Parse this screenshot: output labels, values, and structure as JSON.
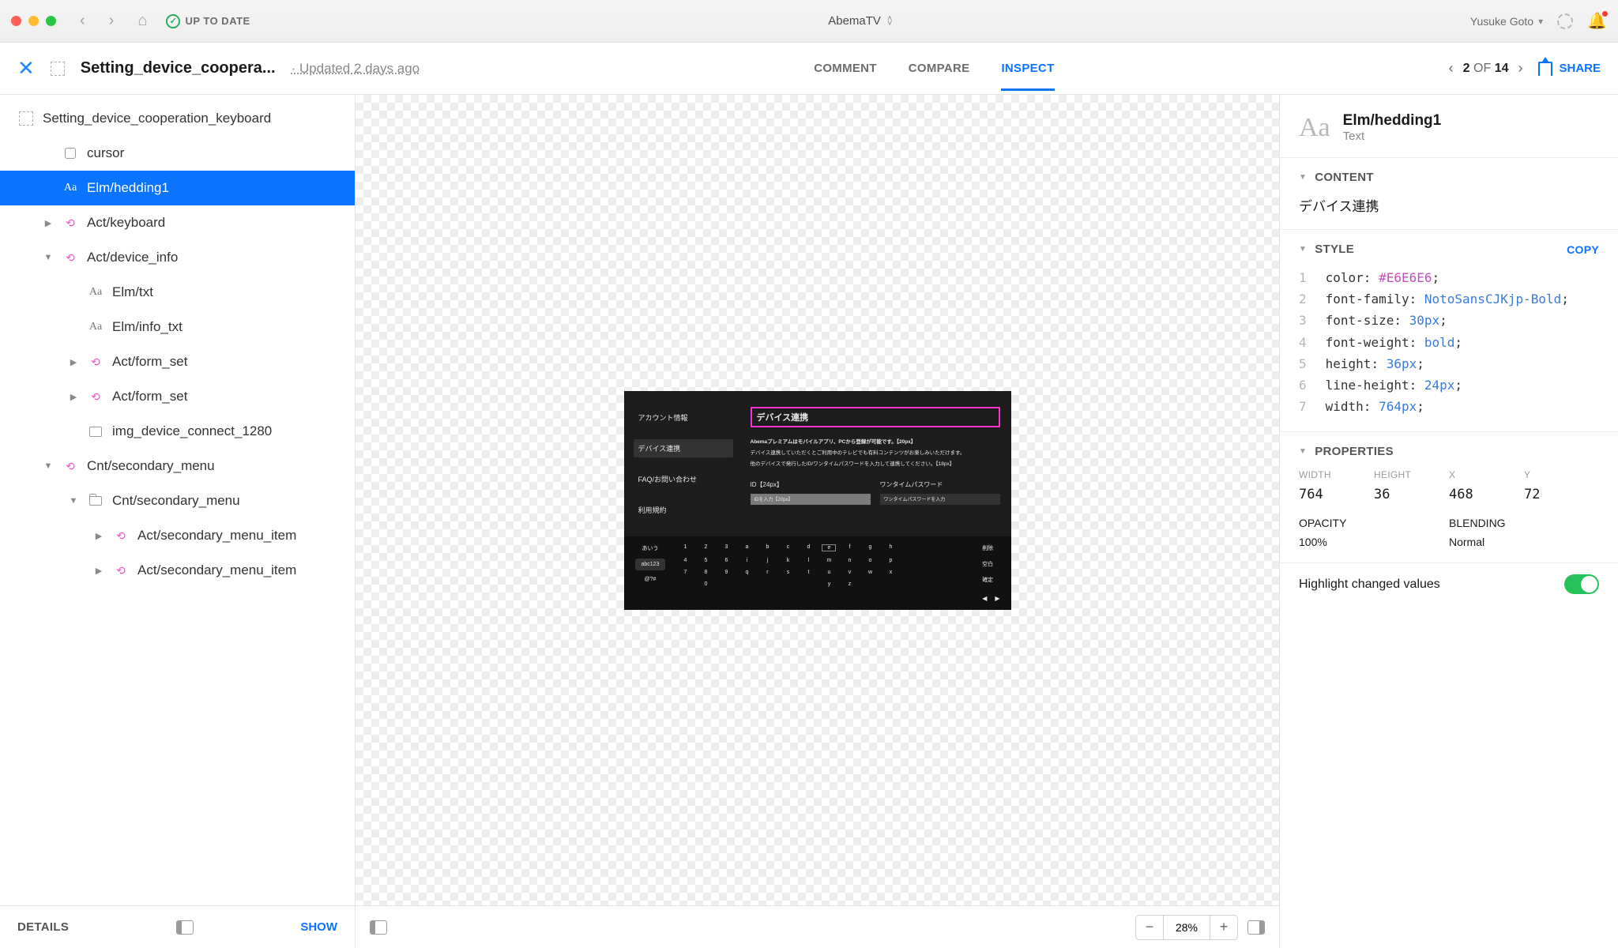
{
  "titlebar": {
    "status": "UP TO DATE",
    "project": "AbemaTV",
    "user": "Yusuke Goto"
  },
  "toolbar": {
    "doc_title": "Setting_device_coopera...",
    "updated": "· Updated 2 days ago",
    "tabs": {
      "comment": "COMMENT",
      "compare": "COMPARE",
      "inspect": "INSPECT"
    },
    "pager_prefix": "2",
    "pager_of": "OF",
    "pager_total": "14",
    "share": "SHARE"
  },
  "tree": {
    "root": "Setting_device_cooperation_keyboard",
    "items": [
      {
        "indent": 1,
        "icon": "cursor",
        "label": "cursor"
      },
      {
        "indent": 1,
        "icon": "text",
        "label": "Elm/hedding1",
        "selected": true
      },
      {
        "indent": 1,
        "icon": "symbol",
        "label": "Act/keyboard",
        "expander": "right"
      },
      {
        "indent": 1,
        "icon": "symbol",
        "label": "Act/device_info",
        "expander": "down"
      },
      {
        "indent": 2,
        "icon": "text",
        "label": "Elm/txt"
      },
      {
        "indent": 2,
        "icon": "text",
        "label": "Elm/info_txt"
      },
      {
        "indent": 2,
        "icon": "symbol",
        "label": "Act/form_set",
        "expander": "right"
      },
      {
        "indent": 2,
        "icon": "symbol",
        "label": "Act/form_set",
        "expander": "right"
      },
      {
        "indent": 2,
        "icon": "image",
        "label": "img_device_connect_1280"
      },
      {
        "indent": 1,
        "icon": "symbol",
        "label": "Cnt/secondary_menu",
        "expander": "down"
      },
      {
        "indent": 2,
        "icon": "folder",
        "label": "Cnt/secondary_menu",
        "expander": "down"
      },
      {
        "indent": 3,
        "icon": "symbol",
        "label": "Act/secondary_menu_item",
        "expander": "right"
      },
      {
        "indent": 3,
        "icon": "symbol",
        "label": "Act/secondary_menu_item",
        "expander": "right"
      }
    ],
    "details": "DETAILS",
    "show": "SHOW"
  },
  "canvas": {
    "zoom": "28%",
    "artboard": {
      "menu": [
        "アカウント情報",
        "デバイス連携",
        "FAQ/お問い合わせ",
        "利用規約"
      ],
      "menu_selected": 1,
      "h1": "デバイス連携",
      "desc1": "Abemaプレミアムはモバイルアプリ、PCから登録が可能です。【20px】",
      "desc2": "デバイス連携していただくとご利用中のテレビでも有料コンテンツがお楽しみいただけます。",
      "desc3": "他のデバイスで発行したID/ワンタイムパスワードを入力して連携してください。【18px】",
      "form1_label": "ID【24px】",
      "form1_ph": "IDを入力【20px】",
      "form2_label": "ワンタイムパスワード",
      "form2_ph": "ワンタイムパスワードを入力",
      "kb_modes": [
        "あいう",
        "abc123",
        "@?#"
      ],
      "kb_rows": [
        [
          "1",
          "2",
          "3",
          "a",
          "b",
          "c",
          "d",
          "e",
          "f",
          "g",
          "h"
        ],
        [
          "4",
          "5",
          "6",
          "i",
          "j",
          "k",
          "l",
          "m",
          "n",
          "o",
          "p"
        ],
        [
          "7",
          "8",
          "9",
          "q",
          "r",
          "s",
          "t",
          "u",
          "v",
          "w",
          "x"
        ],
        [
          "",
          "0",
          "",
          "",
          "",
          "",
          "",
          "y",
          "z",
          "",
          ""
        ]
      ],
      "kb_right": [
        "削除",
        "空白",
        "確定"
      ]
    }
  },
  "inspector": {
    "name": "Elm/hedding1",
    "kind": "Text",
    "sections": {
      "content": "CONTENT",
      "style": "STYLE",
      "properties": "PROPERTIES"
    },
    "content_value": "デバイス連携",
    "copy": "COPY",
    "css": [
      {
        "n": "1",
        "p": "color",
        "v": "#E6E6E6",
        "t": "hex"
      },
      {
        "n": "2",
        "p": "font-family",
        "v": "NotoSansCJKjp-Bold",
        "t": "str"
      },
      {
        "n": "3",
        "p": "font-size",
        "v": "30px",
        "t": "num"
      },
      {
        "n": "4",
        "p": "font-weight",
        "v": "bold",
        "t": "str"
      },
      {
        "n": "5",
        "p": "height",
        "v": "36px",
        "t": "num"
      },
      {
        "n": "6",
        "p": "line-height",
        "v": "24px",
        "t": "num"
      },
      {
        "n": "7",
        "p": "width",
        "v": "764px",
        "t": "num"
      }
    ],
    "props": {
      "width_label": "WIDTH",
      "width": "764",
      "height_label": "HEIGHT",
      "height": "36",
      "x_label": "X",
      "x": "468",
      "y_label": "Y",
      "y": "72",
      "opacity_label": "OPACITY",
      "opacity": "100%",
      "blending_label": "BLENDING",
      "blending": "Normal"
    },
    "footer": "Highlight changed values"
  }
}
